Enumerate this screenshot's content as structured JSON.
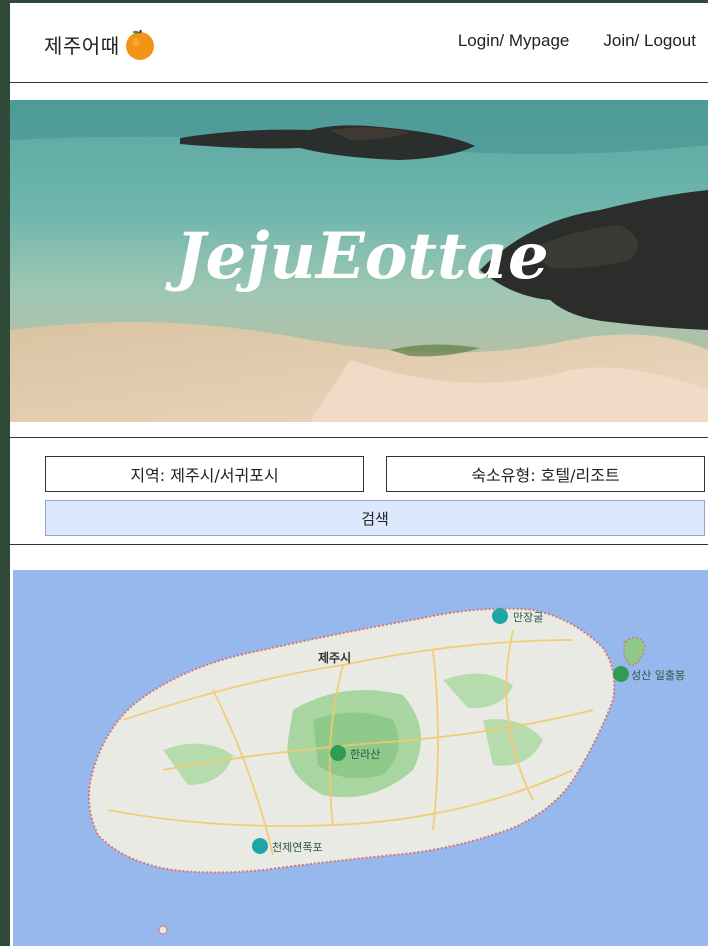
{
  "header": {
    "brand": "제주어때",
    "nav": {
      "login": "Login/ Mypage",
      "join": "Join/ Logout"
    }
  },
  "hero": {
    "title": "JejuEottae"
  },
  "search": {
    "region": "지역: 제주시/서귀포시",
    "lodging": "숙소유형: 호텔/리조트",
    "button": "검색"
  },
  "map": {
    "city": "제주시",
    "poi_manjanggul": "만장굴",
    "poi_hallasan": "한라산",
    "poi_seongsan": "성산 일출봉",
    "poi_cheonjiyeon": "천제연폭포"
  },
  "colors": {
    "search_button_bg": "#dce8fb",
    "sea": "#97b8ec",
    "orange": "#f39418"
  }
}
